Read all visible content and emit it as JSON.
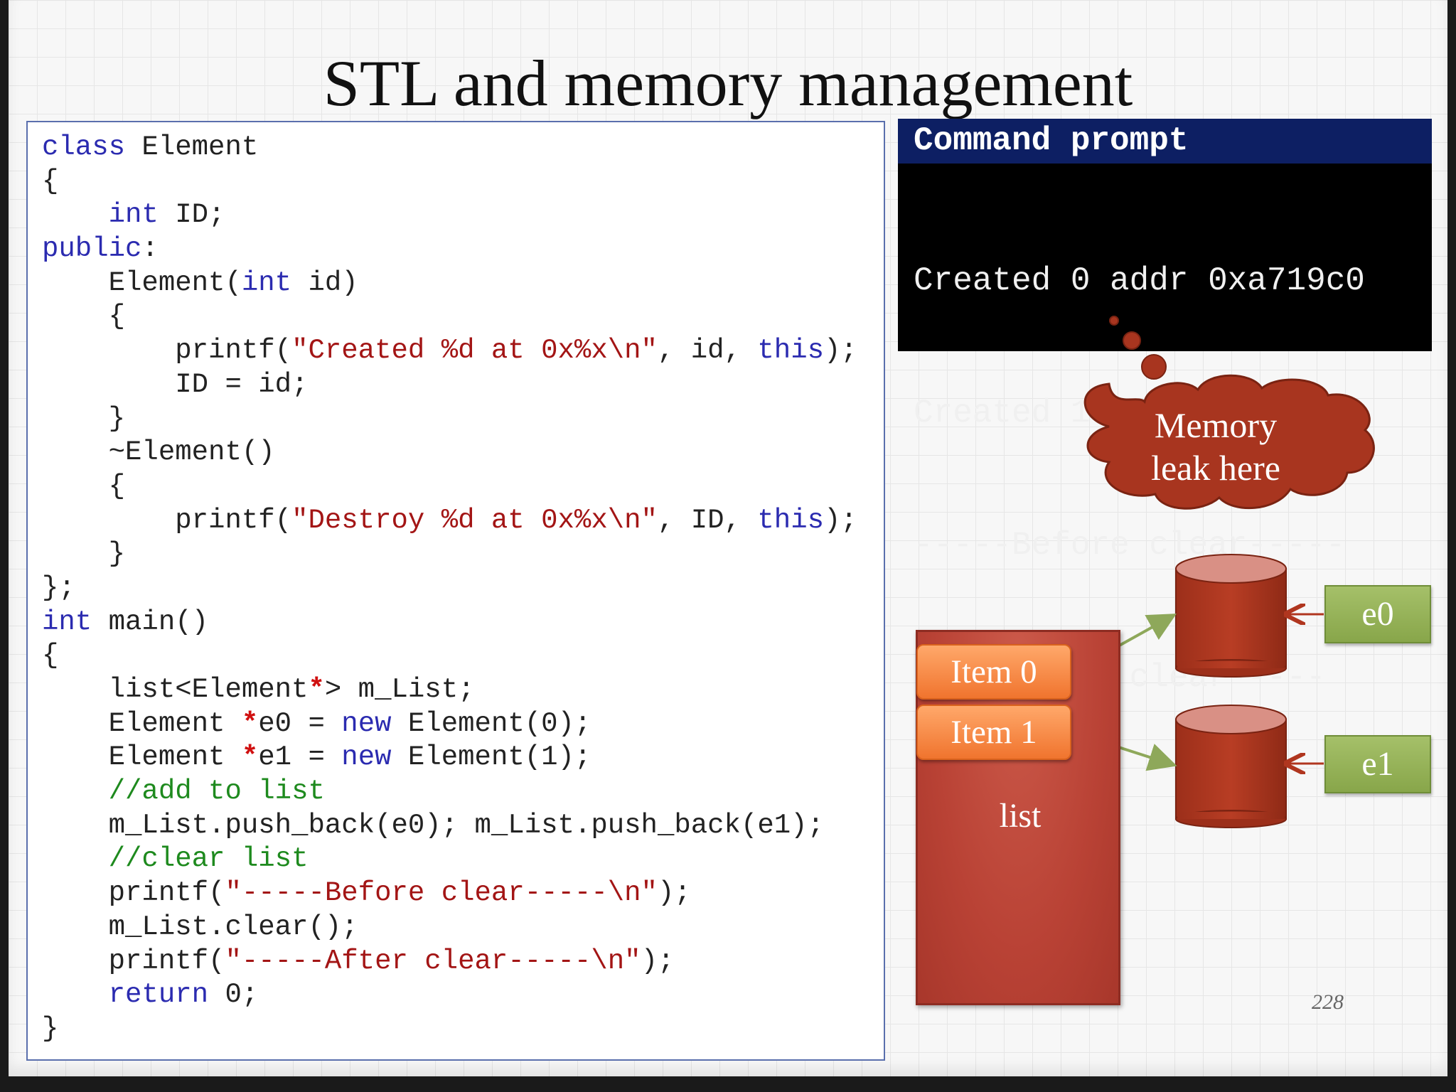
{
  "slide": {
    "title": "STL and memory management",
    "page_number": "228"
  },
  "code": {
    "lines": [
      [
        {
          "t": "kw",
          "v": "class"
        },
        {
          "t": "plain",
          "v": " Element"
        }
      ],
      [
        {
          "t": "plain",
          "v": "{"
        }
      ],
      [
        {
          "t": "plain",
          "v": "    "
        },
        {
          "t": "kw",
          "v": "int"
        },
        {
          "t": "plain",
          "v": " ID;"
        }
      ],
      [
        {
          "t": "kw",
          "v": "public"
        },
        {
          "t": "plain",
          "v": ":"
        }
      ],
      [
        {
          "t": "plain",
          "v": "    Element("
        },
        {
          "t": "kw",
          "v": "int"
        },
        {
          "t": "plain",
          "v": " id)"
        }
      ],
      [
        {
          "t": "plain",
          "v": "    {"
        }
      ],
      [
        {
          "t": "plain",
          "v": "        printf("
        },
        {
          "t": "str",
          "v": "\"Created %d at 0x%x\\n\""
        },
        {
          "t": "plain",
          "v": ", id, "
        },
        {
          "t": "kw",
          "v": "this"
        },
        {
          "t": "plain",
          "v": ");"
        }
      ],
      [
        {
          "t": "plain",
          "v": "        ID = id;"
        }
      ],
      [
        {
          "t": "plain",
          "v": "    }"
        }
      ],
      [
        {
          "t": "plain",
          "v": "    ~Element()"
        }
      ],
      [
        {
          "t": "plain",
          "v": "    {"
        }
      ],
      [
        {
          "t": "plain",
          "v": "        printf("
        },
        {
          "t": "str",
          "v": "\"Destroy %d at 0x%x\\n\""
        },
        {
          "t": "plain",
          "v": ", ID, "
        },
        {
          "t": "kw",
          "v": "this"
        },
        {
          "t": "plain",
          "v": ");"
        }
      ],
      [
        {
          "t": "plain",
          "v": "    }"
        }
      ],
      [
        {
          "t": "plain",
          "v": "};"
        }
      ],
      [
        {
          "t": "kw",
          "v": "int"
        },
        {
          "t": "plain",
          "v": " main()"
        }
      ],
      [
        {
          "t": "plain",
          "v": "{"
        }
      ],
      [
        {
          "t": "plain",
          "v": "    list<Element"
        },
        {
          "t": "star",
          "v": "*"
        },
        {
          "t": "plain",
          "v": "> m_List;"
        }
      ],
      [
        {
          "t": "plain",
          "v": "    Element "
        },
        {
          "t": "star",
          "v": "*"
        },
        {
          "t": "plain",
          "v": "e0 = "
        },
        {
          "t": "kw",
          "v": "new"
        },
        {
          "t": "plain",
          "v": " Element(0);"
        }
      ],
      [
        {
          "t": "plain",
          "v": "    Element "
        },
        {
          "t": "star",
          "v": "*"
        },
        {
          "t": "plain",
          "v": "e1 = "
        },
        {
          "t": "kw",
          "v": "new"
        },
        {
          "t": "plain",
          "v": " Element(1);"
        }
      ],
      [
        {
          "t": "plain",
          "v": "    "
        },
        {
          "t": "cmt",
          "v": "//add to list"
        }
      ],
      [
        {
          "t": "plain",
          "v": "    m_List.push_back(e0); m_List.push_back(e1);"
        }
      ],
      [
        {
          "t": "plain",
          "v": "    "
        },
        {
          "t": "cmt",
          "v": "//clear list"
        }
      ],
      [
        {
          "t": "plain",
          "v": "    printf("
        },
        {
          "t": "str",
          "v": "\"-----Before clear-----\\n\""
        },
        {
          "t": "plain",
          "v": ");"
        }
      ],
      [
        {
          "t": "plain",
          "v": "    m_List.clear();"
        }
      ],
      [
        {
          "t": "plain",
          "v": "    printf("
        },
        {
          "t": "str",
          "v": "\"-----After clear-----\\n\""
        },
        {
          "t": "plain",
          "v": ");"
        }
      ],
      [
        {
          "t": "plain",
          "v": "    "
        },
        {
          "t": "kw",
          "v": "return"
        },
        {
          "t": "plain",
          "v": " 0;"
        }
      ],
      [
        {
          "t": "plain",
          "v": "}"
        }
      ]
    ]
  },
  "console": {
    "title": "Command prompt",
    "lines": [
      "Created 0 addr 0xa719c0",
      "Created 1 addr 0xa81a18",
      "-----Before clear-----",
      "-----After clear-----"
    ]
  },
  "callout": {
    "line1": "Memory",
    "line2": "leak here"
  },
  "diagram": {
    "item0_label": "Item 0",
    "item1_label": "Item 1",
    "list_label": "list",
    "e0_label": "e0",
    "e1_label": "e1"
  },
  "colors": {
    "code_keyword": "#2b2bb0",
    "code_string": "#a31515",
    "code_comment": "#1e8a1e",
    "console_header": "#0d1f63",
    "cloud_fill": "#a8351f",
    "object_fill": "#a8351f",
    "item_fill": "#f58a45",
    "var_fill": "#96b25a"
  }
}
